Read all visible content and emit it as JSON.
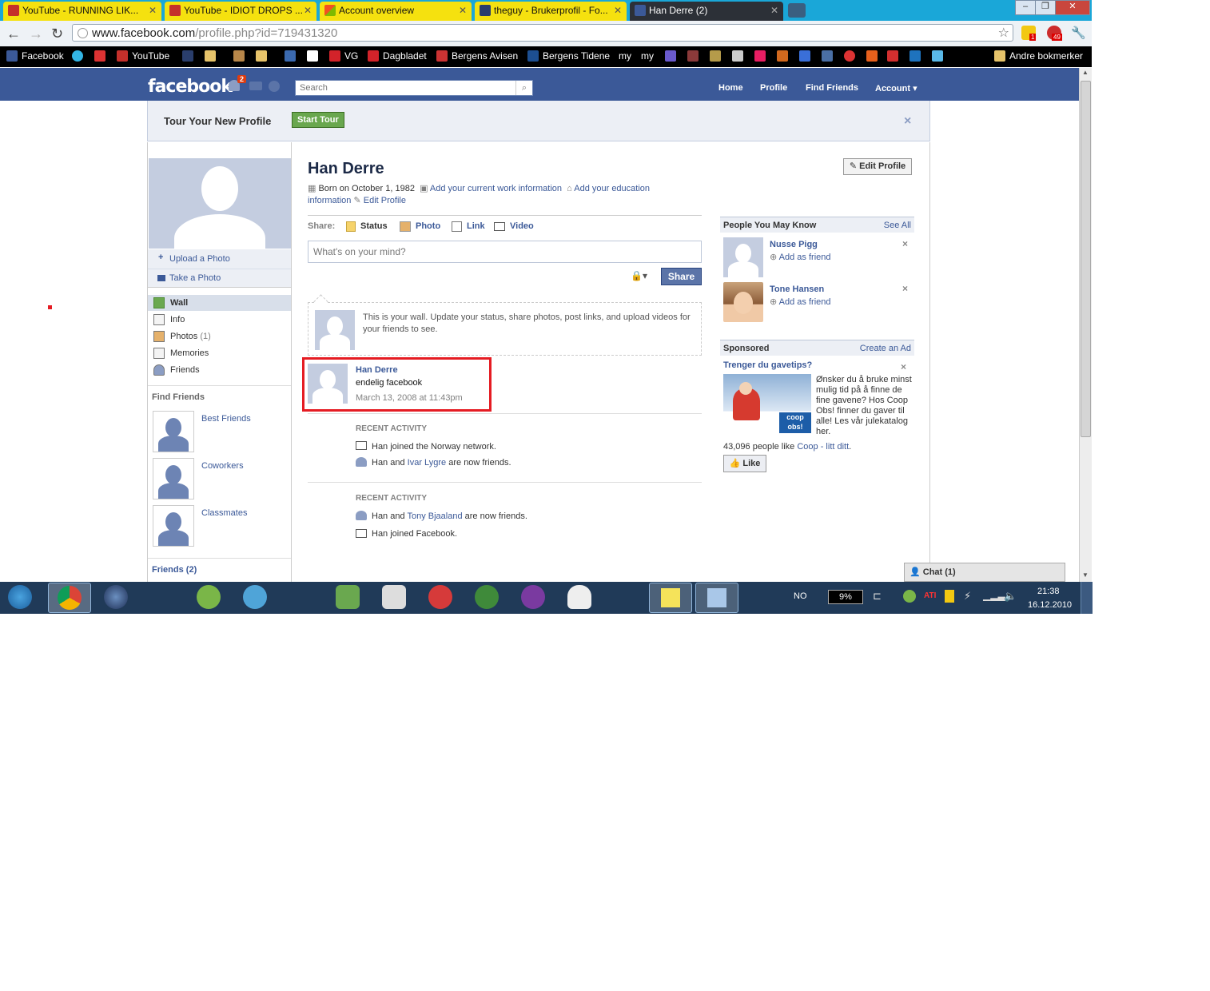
{
  "browser": {
    "tabs": [
      {
        "title": "YouTube - RUNNING LIK..."
      },
      {
        "title": "YouTube - IDIOT DROPS ..."
      },
      {
        "title": "Account overview"
      },
      {
        "title": "theguy - Brukerprofil - Fo..."
      },
      {
        "title": "Han Derre (2)"
      }
    ],
    "url_host": "www.facebook.com",
    "url_path": "/profile.php?id=719431320",
    "ext_badges": {
      "first": "1",
      "second": "49"
    },
    "bookmarks": [
      "Facebook",
      "YouTube",
      "VG",
      "Dagbladet",
      "Bergens Avisen",
      "Bergens Tidene",
      "my",
      "my"
    ],
    "other_bookmarks": "Andre bokmerker"
  },
  "fb": {
    "logo": "facebook",
    "notif_count": "2",
    "search_placeholder": "Search",
    "nav": {
      "home": "Home",
      "profile": "Profile",
      "find_friends": "Find Friends",
      "account": "Account"
    },
    "tour": {
      "title": "Tour Your New Profile",
      "button": "Start Tour",
      "close": "×"
    },
    "left": {
      "upload_photo": "Upload a Photo",
      "take_photo": "Take a Photo",
      "nav_items": [
        "Wall",
        "Info",
        "Photos",
        "Memories",
        "Friends"
      ],
      "photos_count": "(1)",
      "find_friends_header": "Find Friends",
      "friend_lists": [
        "Best Friends",
        "Coworkers",
        "Classmates"
      ],
      "friends_count": "Friends (2)"
    },
    "profile": {
      "name": "Han Derre",
      "edit_button": "Edit Profile",
      "born": "Born on October 1, 1982",
      "add_work": "Add your current work information",
      "add_edu_1": "Add your education",
      "add_edu_2": "information",
      "edit_profile": "Edit Profile"
    },
    "share": {
      "label": "Share:",
      "status": "Status",
      "photo": "Photo",
      "link": "Link",
      "video": "Video",
      "placeholder": "What's on your mind?",
      "button": "Share"
    },
    "wall_intro": "This is your wall. Update your status, share photos, post links, and upload videos for your friends to see.",
    "post": {
      "author": "Han Derre",
      "text": "endelig facebook",
      "time": "March 13, 2008 at 11:43pm"
    },
    "activity1": {
      "header": "RECENT ACTIVITY",
      "line1": "Han joined the Norway network.",
      "line2_pre": "Han and",
      "line2_link": "Ivar Lygre",
      "line2_post": "are now friends."
    },
    "activity2": {
      "header": "RECENT ACTIVITY",
      "line1_pre": "Han and",
      "line1_link": "Tony Bjaaland",
      "line1_post": "are now friends.",
      "line2": "Han joined Facebook."
    },
    "pymk": {
      "header": "People You May Know",
      "see_all": "See All",
      "people": [
        {
          "name": "Nusse Pigg",
          "action": "Add as friend"
        },
        {
          "name": "Tone Hansen",
          "action": "Add as friend"
        }
      ]
    },
    "sponsored": {
      "header": "Sponsored",
      "create_ad": "Create an Ad",
      "ad_title": "Trenger du gavetips?",
      "ad_text": "Ønsker du å bruke minst mulig tid på å finne de fine gavene? Hos Coop Obs! finner du gaver til alle! Les vår julekatalog her.",
      "likes_pre": "43,096 people like",
      "likes_link": "Coop - litt ditt",
      "like_button": "Like",
      "ad_logo": "coop obs!"
    },
    "chat": "Chat (1)"
  },
  "taskbar": {
    "lang": "NO",
    "battery": "9%",
    "time": "21:38",
    "date": "16.12.2010"
  }
}
